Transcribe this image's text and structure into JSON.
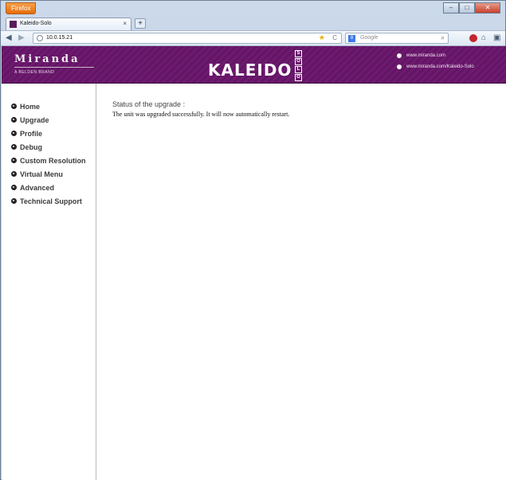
{
  "browser": {
    "menu_button": "Firefox",
    "tab_title": "Kaleido-Solo",
    "tab_close": "×",
    "new_tab": "+",
    "url": "10.0.15.21",
    "search_placeholder": "Google",
    "search_engine_glyph": "8"
  },
  "header": {
    "brand": "Miranda",
    "brand_subtitle": "A BELDEN BRAND",
    "product": "KALEIDO",
    "product_suffix": [
      "S",
      "O",
      "L",
      "O"
    ],
    "links": [
      "www.miranda.com",
      "www.miranda.com/Kaleido-Solo"
    ]
  },
  "sidebar": {
    "items": [
      {
        "label": "Home"
      },
      {
        "label": "Upgrade"
      },
      {
        "label": "Profile"
      },
      {
        "label": "Debug"
      },
      {
        "label": "Custom Resolution"
      },
      {
        "label": "Virtual Menu"
      },
      {
        "label": "Advanced"
      },
      {
        "label": "Technical Support"
      }
    ]
  },
  "main": {
    "status_heading": "Status of the upgrade :",
    "status_message": "The unit was upgraded successfully. It will now automatically restart."
  },
  "colors": {
    "banner": "#6e1a6f",
    "firefox_button": "#e66b09"
  }
}
